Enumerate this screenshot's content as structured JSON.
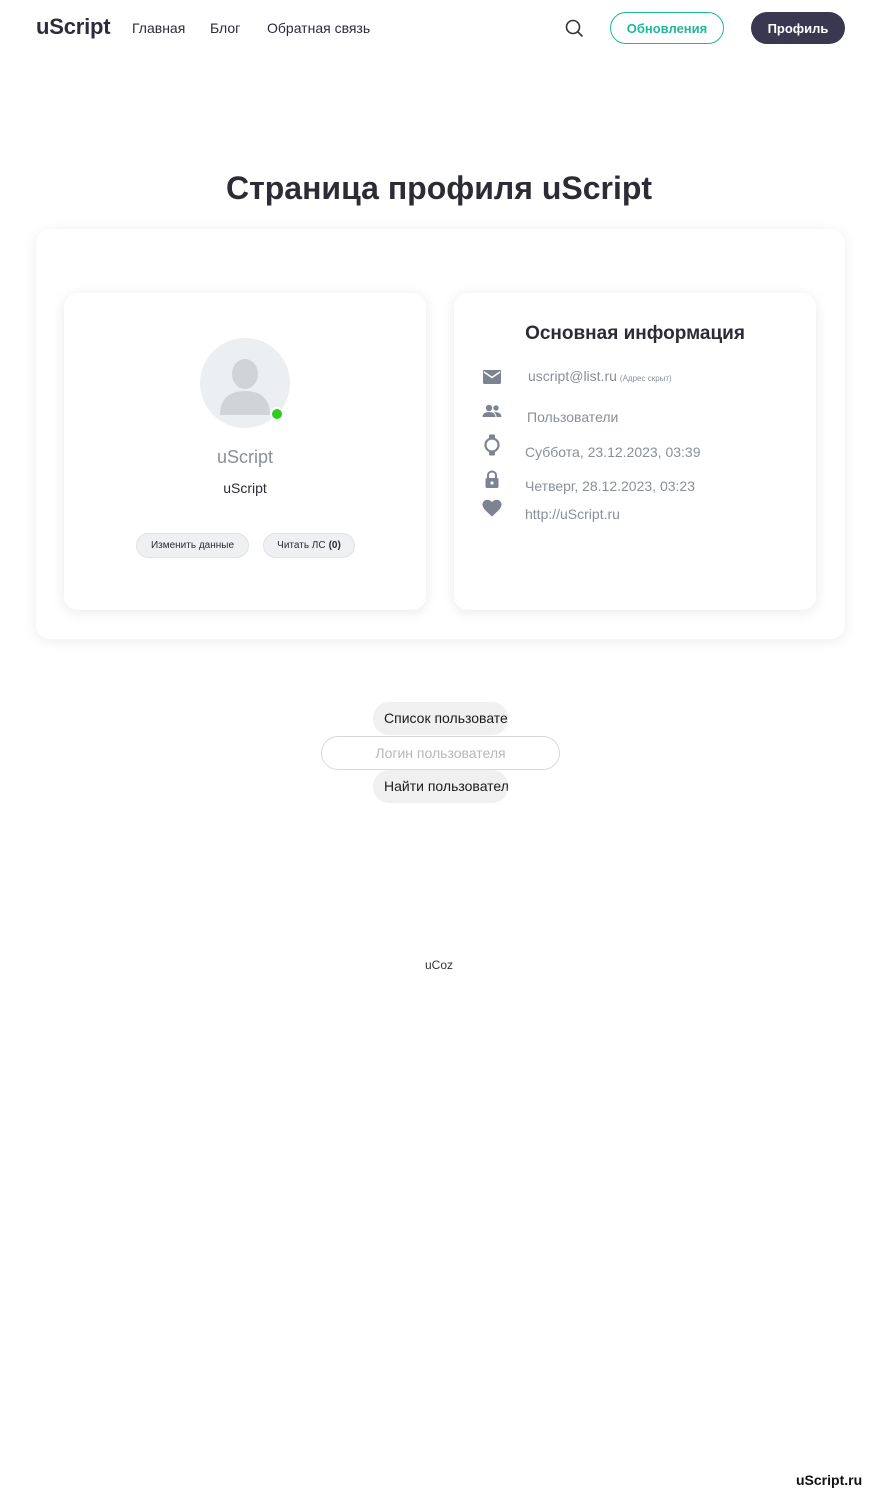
{
  "header": {
    "logo": "uScript",
    "nav": {
      "home": "Главная",
      "blog": "Блог",
      "feedback": "Обратная связь"
    },
    "updates_label": "Обновления",
    "profile_label": "Профиль"
  },
  "page": {
    "title": "Страница профиля uScript"
  },
  "profile": {
    "name": "uScript",
    "group": "uScript",
    "status": "online",
    "edit_label": "Изменить данные",
    "pm_label": "Читать ЛС",
    "pm_count": "(0)"
  },
  "info": {
    "title": "Основная информация",
    "email": "uscript@list.ru",
    "email_note": "(Адрес скрыт)",
    "group": "Пользователи",
    "registered": "Суббота, 23.12.2023, 03:39",
    "last_login": "Четверг, 28.12.2023, 03:23",
    "website": "http://uScript.ru"
  },
  "search": {
    "list_label": "Список пользователей",
    "placeholder": "Логин пользователя",
    "find_label": "Найти пользователя"
  },
  "footer": {
    "ucoz": "uCoz",
    "watermark": "uScript.ru"
  },
  "colors": {
    "accent": "#1fb89a",
    "dark": "#3a3851",
    "online": "#2ecc1f",
    "muted": "#8a8f99"
  }
}
